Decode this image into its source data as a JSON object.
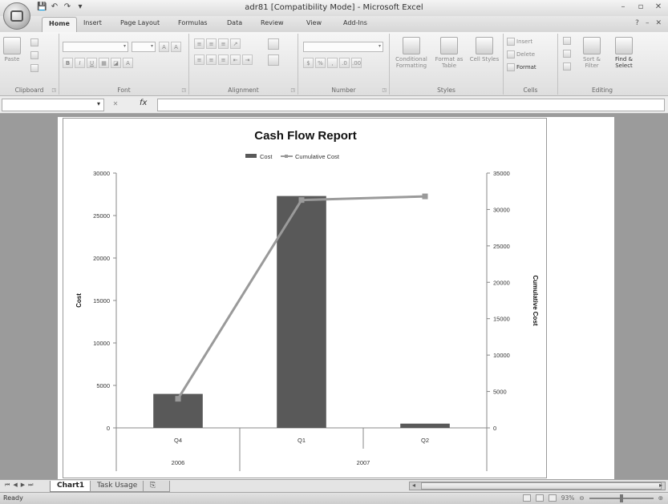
{
  "window": {
    "title": "adr81  [Compatibility Mode] - Microsoft Excel",
    "min_glyph": "–",
    "restore_glyph": "▫",
    "close_glyph": "✕"
  },
  "quick_access": {
    "save": "💾",
    "undo": "↶",
    "redo": "↷",
    "customize": "▾"
  },
  "ribbon": {
    "tabs": [
      "Home",
      "Insert",
      "Page Layout",
      "Formulas",
      "Data",
      "Review",
      "View",
      "Add-Ins"
    ],
    "active_tab": "Home",
    "help_glyph": "?",
    "groups": {
      "clipboard": {
        "label": "Clipboard",
        "paste": "Paste"
      },
      "font": {
        "label": "Font"
      },
      "alignment": {
        "label": "Alignment"
      },
      "number": {
        "label": "Number"
      },
      "styles": {
        "label": "Styles",
        "conditional": "Conditional Formatting",
        "format_table": "Format as Table",
        "cell_styles": "Cell Styles"
      },
      "cells": {
        "label": "Cells",
        "insert": "Insert",
        "delete": "Delete",
        "format": "Format"
      },
      "editing": {
        "label": "Editing",
        "sort": "Sort & Filter",
        "find": "Find & Select"
      }
    }
  },
  "formula_bar": {
    "name_box": "",
    "fx": "fx",
    "formula": ""
  },
  "chart_data": {
    "type": "bar",
    "title": "Cash Flow Report",
    "legend": {
      "position": "top",
      "entries": [
        "Cost",
        "Cumulative Cost"
      ]
    },
    "categories": [
      "Q4",
      "Q1",
      "Q2"
    ],
    "category_groups": [
      {
        "label": "2006",
        "span": 1
      },
      {
        "label": "2007",
        "span": 2
      }
    ],
    "series": [
      {
        "name": "Cost",
        "type": "bar",
        "axis": "left",
        "values": [
          4000,
          27300,
          500
        ],
        "color": "#595959"
      },
      {
        "name": "Cumulative Cost",
        "type": "line",
        "axis": "right",
        "values": [
          4000,
          31300,
          31800
        ],
        "color": "#9a9a9a"
      }
    ],
    "ylabel": "Cost",
    "y2label": "Cumulative Cost",
    "ylim": [
      0,
      30000
    ],
    "y2lim": [
      0,
      35000
    ],
    "yticks": [
      0,
      5000,
      10000,
      15000,
      20000,
      25000,
      30000
    ],
    "y2ticks": [
      0,
      5000,
      10000,
      15000,
      20000,
      25000,
      30000,
      35000
    ],
    "grid": false
  },
  "sheet_tabs": {
    "tabs": [
      "Chart1",
      "Task Usage"
    ],
    "active": "Chart1"
  },
  "status_bar": {
    "status": "Ready",
    "zoom": "93%"
  }
}
